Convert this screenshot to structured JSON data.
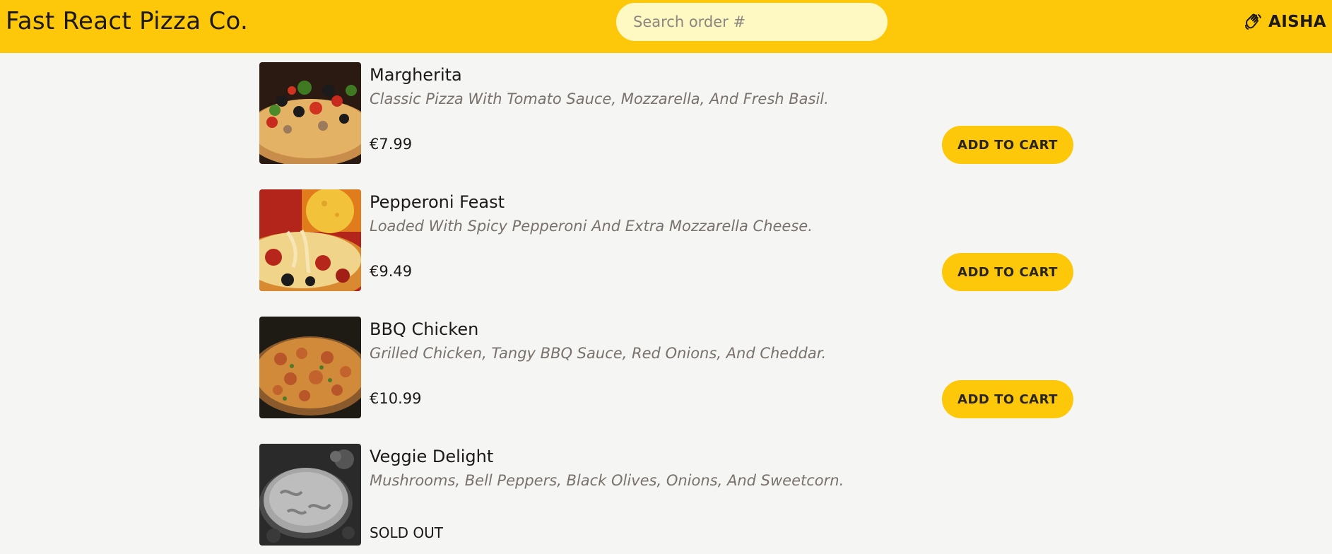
{
  "header": {
    "logo": "Fast React Pizza Co.",
    "search_placeholder": "Search order #",
    "search_value": "",
    "user_icon": "waving-hand-icon",
    "user_name": "AISHA"
  },
  "menu": {
    "items": [
      {
        "name": "Margherita",
        "description": "Classic Pizza With Tomato Sauce, Mozzarella, And Fresh Basil.",
        "price": "€7.99",
        "button": "ADD TO CART"
      },
      {
        "name": "Pepperoni Feast",
        "description": "Loaded With Spicy Pepperoni And Extra Mozzarella Cheese.",
        "price": "€9.49",
        "button": "ADD TO CART"
      },
      {
        "name": "BBQ Chicken",
        "description": "Grilled Chicken, Tangy BBQ Sauce, Red Onions, And Cheddar.",
        "price": "€10.99",
        "button": "ADD TO CART"
      },
      {
        "name": "Veggie Delight",
        "description": "Mushrooms, Bell Peppers, Black Olives, Onions, And Sweetcorn.",
        "status": "SOLD OUT"
      }
    ]
  },
  "colors": {
    "brand_yellow": "#fdc70a",
    "search_bg": "#fef8c3",
    "page_bg": "#f5f5f3",
    "muted_text": "#78716c"
  }
}
